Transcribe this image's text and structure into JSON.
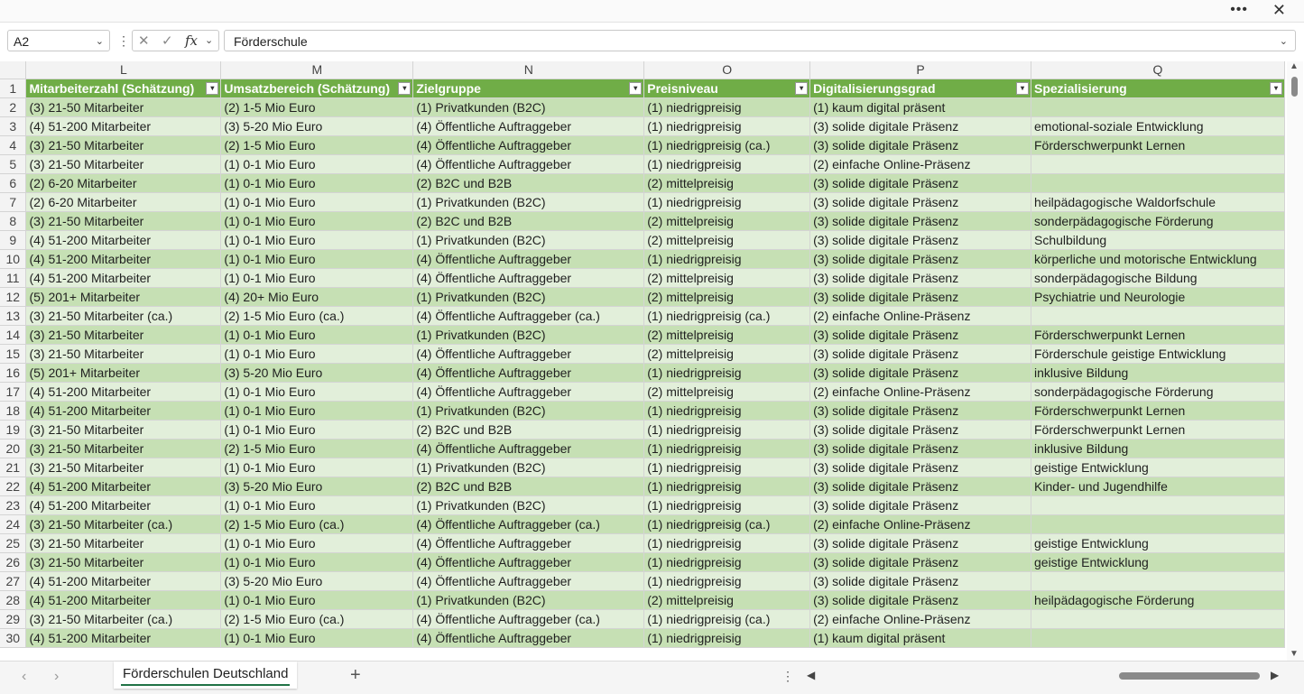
{
  "window": {
    "more_label": "•••",
    "close_label": "✕"
  },
  "formula_bar": {
    "name_box": "A2",
    "name_box_chevron": "⌄",
    "menu_label": "⋮",
    "cancel_label": "✕",
    "enter_label": "✓",
    "fx_label": "fx",
    "fx_chevron": "⌄",
    "formula_value": "Förderschule",
    "formula_chevron": "⌄"
  },
  "columns": [
    "L",
    "M",
    "N",
    "O",
    "P",
    "Q"
  ],
  "headers": [
    "Mitarbeiterzahl (Schätzung)",
    "Umsatzbereich (Schätzung)",
    "Zielgruppe",
    "Preisniveau",
    "Digitalisierungsgrad",
    "Spezialisierung"
  ],
  "filter_icon": "▾",
  "row_numbers": [
    "1",
    "2",
    "3",
    "4",
    "5",
    "6",
    "7",
    "8",
    "9",
    "10",
    "11",
    "12",
    "13",
    "14",
    "15",
    "16",
    "17",
    "18",
    "19",
    "20",
    "21",
    "22",
    "23",
    "24",
    "25",
    "26",
    "27",
    "28",
    "29",
    "30"
  ],
  "rows": [
    [
      "(3) 21-50 Mitarbeiter",
      "(2) 1-5 Mio Euro",
      "(1) Privatkunden (B2C)",
      "(1) niedrigpreisig",
      "(1) kaum digital präsent",
      ""
    ],
    [
      "(4) 51-200 Mitarbeiter",
      "(3) 5-20 Mio Euro",
      "(4) Öffentliche Auftraggeber",
      "(1) niedrigpreisig",
      "(3) solide digitale Präsenz",
      "emotional-soziale Entwicklung"
    ],
    [
      "(3) 21-50 Mitarbeiter",
      "(2) 1-5 Mio Euro",
      "(4) Öffentliche Auftraggeber",
      "(1) niedrigpreisig (ca.)",
      "(3) solide digitale Präsenz",
      "Förderschwerpunkt Lernen"
    ],
    [
      "(3) 21-50 Mitarbeiter",
      "(1) 0-1 Mio Euro",
      "(4) Öffentliche Auftraggeber",
      "(1) niedrigpreisig",
      "(2) einfache Online-Präsenz",
      ""
    ],
    [
      "(2) 6-20 Mitarbeiter",
      "(1) 0-1 Mio Euro",
      "(2) B2C und B2B",
      "(2) mittelpreisig",
      "(3) solide digitale Präsenz",
      ""
    ],
    [
      "(2) 6-20 Mitarbeiter",
      "(1) 0-1 Mio Euro",
      "(1) Privatkunden (B2C)",
      "(1) niedrigpreisig",
      "(3) solide digitale Präsenz",
      "heilpädagogische Waldorfschule"
    ],
    [
      "(3) 21-50 Mitarbeiter",
      "(1) 0-1 Mio Euro",
      "(2) B2C und B2B",
      "(2) mittelpreisig",
      "(3) solide digitale Präsenz",
      "sonderpädagogische Förderung"
    ],
    [
      "(4) 51-200 Mitarbeiter",
      "(1) 0-1 Mio Euro",
      "(1) Privatkunden (B2C)",
      "(2) mittelpreisig",
      "(3) solide digitale Präsenz",
      "Schulbildung"
    ],
    [
      "(4) 51-200 Mitarbeiter",
      "(1) 0-1 Mio Euro",
      "(4) Öffentliche Auftraggeber",
      "(1) niedrigpreisig",
      "(3) solide digitale Präsenz",
      "körperliche und motorische Entwicklung"
    ],
    [
      "(4) 51-200 Mitarbeiter",
      "(1) 0-1 Mio Euro",
      "(4) Öffentliche Auftraggeber",
      "(2) mittelpreisig",
      "(3) solide digitale Präsenz",
      "sonderpädagogische Bildung"
    ],
    [
      "(5) 201+ Mitarbeiter",
      "(4) 20+ Mio Euro",
      "(1) Privatkunden (B2C)",
      "(2) mittelpreisig",
      "(3) solide digitale Präsenz",
      "Psychiatrie und Neurologie"
    ],
    [
      "(3) 21-50 Mitarbeiter (ca.)",
      "(2) 1-5 Mio Euro (ca.)",
      "(4) Öffentliche Auftraggeber (ca.)",
      "(1) niedrigpreisig (ca.)",
      "(2) einfache Online-Präsenz",
      ""
    ],
    [
      "(3) 21-50 Mitarbeiter",
      "(1) 0-1 Mio Euro",
      "(1) Privatkunden (B2C)",
      "(2) mittelpreisig",
      "(3) solide digitale Präsenz",
      "Förderschwerpunkt Lernen"
    ],
    [
      "(3) 21-50 Mitarbeiter",
      "(1) 0-1 Mio Euro",
      "(4) Öffentliche Auftraggeber",
      "(2) mittelpreisig",
      "(3) solide digitale Präsenz",
      "Förderschule geistige Entwicklung"
    ],
    [
      "(5) 201+ Mitarbeiter",
      "(3) 5-20 Mio Euro",
      "(4) Öffentliche Auftraggeber",
      "(1) niedrigpreisig",
      "(3) solide digitale Präsenz",
      "inklusive Bildung"
    ],
    [
      "(4) 51-200 Mitarbeiter",
      "(1) 0-1 Mio Euro",
      "(4) Öffentliche Auftraggeber",
      "(2) mittelpreisig",
      "(2) einfache Online-Präsenz",
      "sonderpädagogische Förderung"
    ],
    [
      "(4) 51-200 Mitarbeiter",
      "(1) 0-1 Mio Euro",
      "(1) Privatkunden (B2C)",
      "(1) niedrigpreisig",
      "(3) solide digitale Präsenz",
      "Förderschwerpunkt Lernen"
    ],
    [
      "(3) 21-50 Mitarbeiter",
      "(1) 0-1 Mio Euro",
      "(2) B2C und B2B",
      "(1) niedrigpreisig",
      "(3) solide digitale Präsenz",
      "Förderschwerpunkt Lernen"
    ],
    [
      "(3) 21-50 Mitarbeiter",
      "(2) 1-5 Mio Euro",
      "(4) Öffentliche Auftraggeber",
      "(1) niedrigpreisig",
      "(3) solide digitale Präsenz",
      "inklusive Bildung"
    ],
    [
      "(3) 21-50 Mitarbeiter",
      "(1) 0-1 Mio Euro",
      "(1) Privatkunden (B2C)",
      "(1) niedrigpreisig",
      "(3) solide digitale Präsenz",
      "geistige Entwicklung"
    ],
    [
      "(4) 51-200 Mitarbeiter",
      "(3) 5-20 Mio Euro",
      "(2) B2C und B2B",
      "(1) niedrigpreisig",
      "(3) solide digitale Präsenz",
      "Kinder- und Jugendhilfe"
    ],
    [
      "(4) 51-200 Mitarbeiter",
      "(1) 0-1 Mio Euro",
      "(1) Privatkunden (B2C)",
      "(1) niedrigpreisig",
      "(3) solide digitale Präsenz",
      ""
    ],
    [
      "(3) 21-50 Mitarbeiter (ca.)",
      "(2) 1-5 Mio Euro (ca.)",
      "(4) Öffentliche Auftraggeber (ca.)",
      "(1) niedrigpreisig (ca.)",
      "(2) einfache Online-Präsenz",
      ""
    ],
    [
      "(3) 21-50 Mitarbeiter",
      "(1) 0-1 Mio Euro",
      "(4) Öffentliche Auftraggeber",
      "(1) niedrigpreisig",
      "(3) solide digitale Präsenz",
      "geistige Entwicklung"
    ],
    [
      "(3) 21-50 Mitarbeiter",
      "(1) 0-1 Mio Euro",
      "(4) Öffentliche Auftraggeber",
      "(1) niedrigpreisig",
      "(3) solide digitale Präsenz",
      "geistige Entwicklung"
    ],
    [
      "(4) 51-200 Mitarbeiter",
      "(3) 5-20 Mio Euro",
      "(4) Öffentliche Auftraggeber",
      "(1) niedrigpreisig",
      "(3) solide digitale Präsenz",
      ""
    ],
    [
      "(4) 51-200 Mitarbeiter",
      "(1) 0-1 Mio Euro",
      "(1) Privatkunden (B2C)",
      "(2) mittelpreisig",
      "(3) solide digitale Präsenz",
      "heilpädagogische Förderung"
    ],
    [
      "(3) 21-50 Mitarbeiter (ca.)",
      "(2) 1-5 Mio Euro (ca.)",
      "(4) Öffentliche Auftraggeber (ca.)",
      "(1) niedrigpreisig (ca.)",
      "(2) einfache Online-Präsenz",
      ""
    ],
    [
      "(4) 51-200 Mitarbeiter",
      "(1) 0-1 Mio Euro",
      "(4) Öffentliche Auftraggeber",
      "(1) niedrigpreisig",
      "(1) kaum digital präsent",
      ""
    ]
  ],
  "sheet_bar": {
    "prev_label": "‹",
    "next_label": "›",
    "active_sheet": "Förderschulen Deutschland",
    "add_label": "+",
    "more_label": "⋮",
    "scroll_left_label": "◀",
    "scroll_right_label": "▶"
  },
  "scroll": {
    "up_label": "▲",
    "down_label": "▼"
  },
  "colors": {
    "header_fill": "#70ad47",
    "band_dark": "#c6e0b4",
    "band_light": "#e2efda",
    "header_text": "#ffffff"
  }
}
